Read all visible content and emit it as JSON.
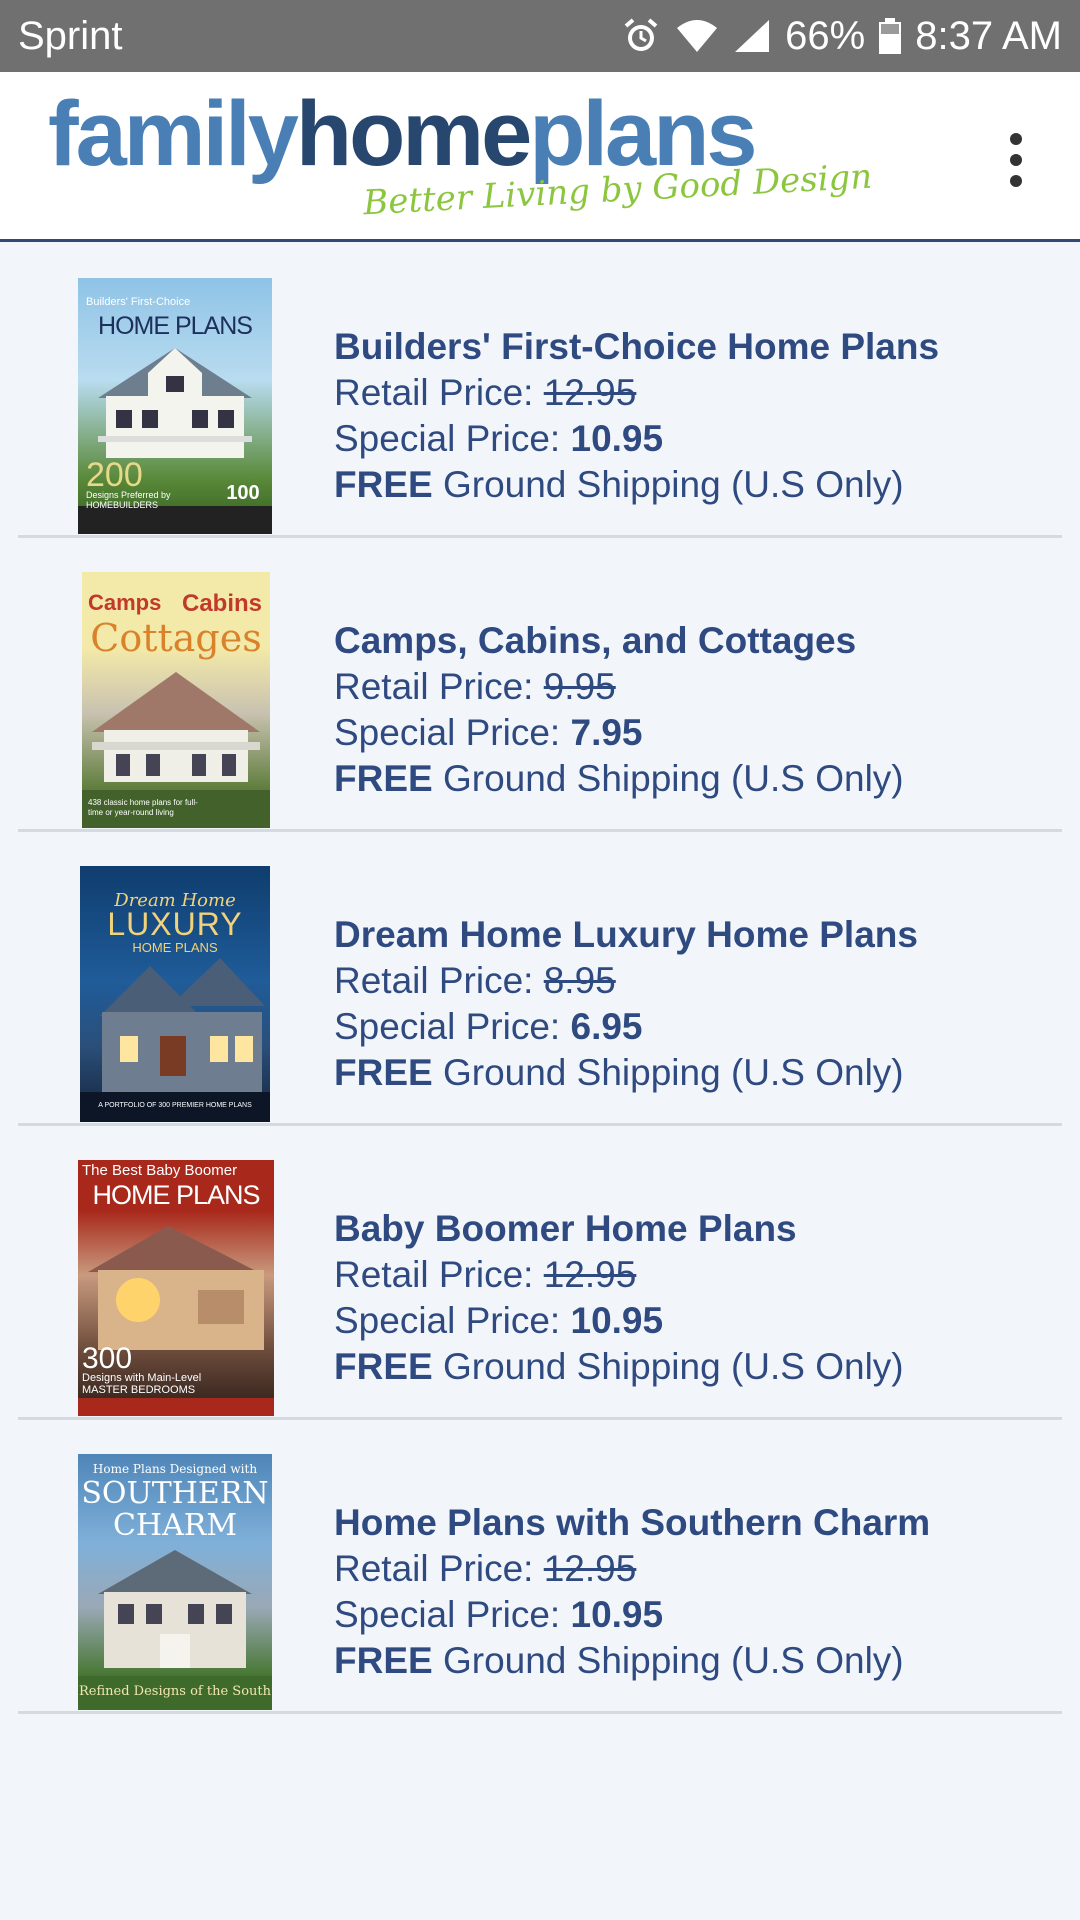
{
  "status_bar": {
    "carrier": "Sprint",
    "battery": "66%",
    "time": "8:37 AM"
  },
  "header": {
    "logo_part1": "family",
    "logo_part2": "home",
    "logo_part3": "plans",
    "tagline": "Better Living by Good Design"
  },
  "labels": {
    "retail": "Retail Price: ",
    "special": "Special Price: ",
    "free": "FREE",
    "shipping": " Ground Shipping (U.S Only)"
  },
  "books": [
    {
      "title": "Builders' First-Choice Home Plans",
      "retail_price": "12.95",
      "special_price": "10.95",
      "cover": {
        "line1": "Builders' First-Choice",
        "line2": "HOME PLANS",
        "line3": "200",
        "line4": "Designs Preferred by HOMEBUILDERS",
        "badge": "100"
      }
    },
    {
      "title": "Camps, Cabins, and Cottages",
      "retail_price": "9.95",
      "special_price": "7.95",
      "cover": {
        "line1": "Camps",
        "line2": "Cabins",
        "line3": "Cottages",
        "line4": "438 classic home plans for full-time or year-round living"
      }
    },
    {
      "title": "Dream Home Luxury Home Plans",
      "retail_price": "8.95",
      "special_price": "6.95",
      "cover": {
        "line1": "Dream Home",
        "line2": "LUXURY",
        "line3": "HOME PLANS",
        "line4": "A PORTFOLIO OF 300 PREMIER HOME PLANS"
      }
    },
    {
      "title": "Baby Boomer Home Plans",
      "retail_price": "12.95",
      "special_price": "10.95",
      "cover": {
        "line1": "The Best Baby Boomer",
        "line2": "HOME PLANS",
        "line3": "300",
        "line4": "Designs with Main-Level MASTER BEDROOMS"
      }
    },
    {
      "title": "Home Plans with Southern Charm",
      "retail_price": "12.95",
      "special_price": "10.95",
      "cover": {
        "line1": "Home Plans Designed with",
        "line2": "SOUTHERN",
        "line3": "CHARM",
        "line4": "Refined Designs of the South"
      }
    }
  ],
  "colors": {
    "status_bar": "#707070",
    "text_primary": "#2f4a80",
    "divider": "#d5dae0",
    "background": "#f2f6fa"
  }
}
